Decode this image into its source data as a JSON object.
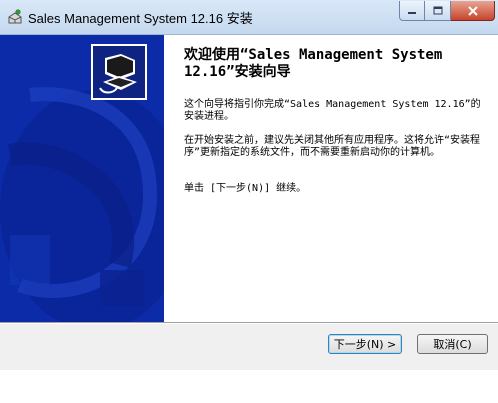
{
  "window": {
    "title": "Sales Management System 12.16 安装"
  },
  "content": {
    "heading": "欢迎使用“Sales Management System 12.16”安装向导",
    "paragraph1": "这个向导将指引你完成“Sales Management System 12.16”的安装进程。",
    "paragraph2": "在开始安装之前，建议先关闭其他所有应用程序。这将允许“安装程序”更新指定的系统文件，而不需要重新启动你的计算机。",
    "paragraph3": "单击 [下一步(N)] 继续。"
  },
  "buttons": {
    "next_label": "下一步(N) >",
    "cancel_label": "取消(C)"
  },
  "colors": {
    "sidebar_blue": "#0c2ba8",
    "titlebar": "#c4d8ee",
    "close_button": "#c7442c"
  }
}
